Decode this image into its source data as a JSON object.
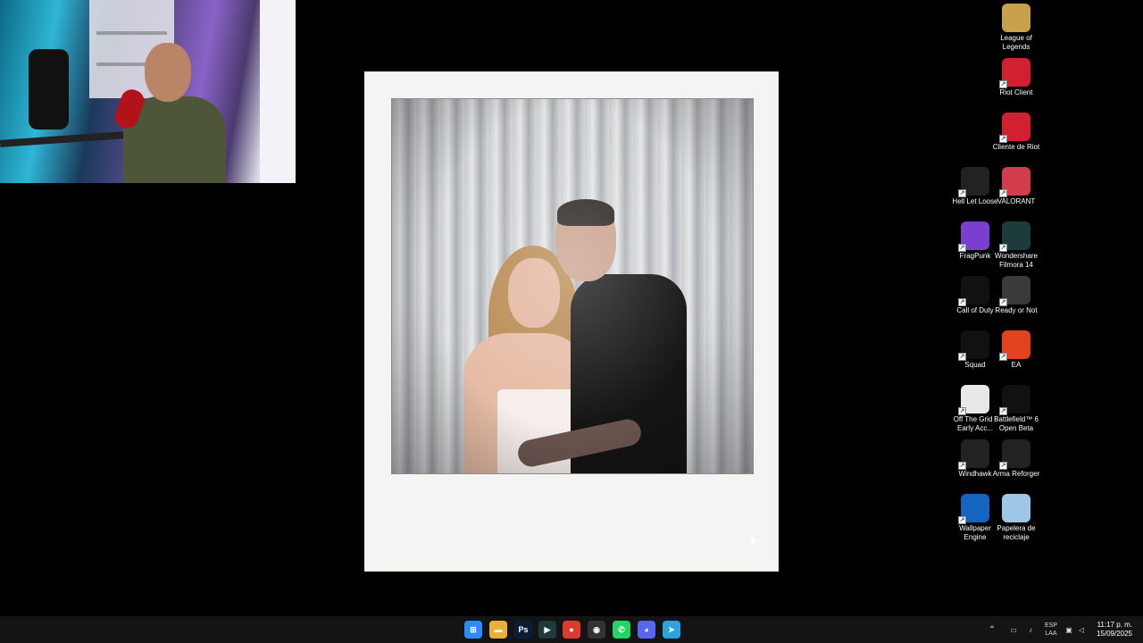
{
  "desktop_icons": [
    {
      "label": "League of Legends",
      "icon": "league-of-legends-icon",
      "color": "#c8a24a"
    },
    {
      "label": "Riot Client",
      "icon": "riot-client-icon",
      "color": "#d1202f"
    },
    {
      "label": "Cliente de Riot",
      "icon": "riot-client-es-icon",
      "color": "#d1202f"
    },
    {
      "label": "Hell Let Loose",
      "icon": "hell-let-loose-icon",
      "color": "#222222"
    },
    {
      "label": "VALORANT",
      "icon": "valorant-icon",
      "color": "#d13d4a"
    },
    {
      "label": "FragPunk",
      "icon": "fragpunk-icon",
      "color": "#7b3fd0"
    },
    {
      "label": "Wondershare Filmora 14",
      "icon": "filmora-icon",
      "color": "#1d3b3a"
    },
    {
      "label": "Call of Duty",
      "icon": "call-of-duty-icon",
      "color": "#111111"
    },
    {
      "label": "Ready or Not",
      "icon": "ready-or-not-icon",
      "color": "#3a3a3a"
    },
    {
      "label": "Squad",
      "icon": "squad-icon",
      "color": "#111111"
    },
    {
      "label": "EA",
      "icon": "ea-icon",
      "color": "#e0431e"
    },
    {
      "label": "Off The Grid - Early Acc...",
      "icon": "off-the-grid-icon",
      "color": "#e8e8e8"
    },
    {
      "label": "Battlefield™ 6 Open Beta",
      "icon": "battlefield-icon",
      "color": "#111111"
    },
    {
      "label": "Windhawk",
      "icon": "windhawk-icon",
      "color": "#222222"
    },
    {
      "label": "Arma Reforger",
      "icon": "arma-reforger-icon",
      "color": "#222222"
    },
    {
      "label": "Wallpaper Engine",
      "icon": "wallpaper-engine-icon",
      "color": "#1565c0"
    },
    {
      "label": "Papelera de reciclaje",
      "icon": "recycle-bin-icon",
      "color": "#9ec6e6"
    }
  ],
  "taskbar": {
    "apps": [
      {
        "name": "start-button",
        "glyph": "⊞",
        "color": "#2b8cff"
      },
      {
        "name": "file-explorer-icon",
        "glyph": "▬",
        "color": "#e8b03a"
      },
      {
        "name": "photoshop-icon",
        "glyph": "Ps",
        "color": "#0a1d35"
      },
      {
        "name": "filmora-taskbar-icon",
        "glyph": "▶",
        "color": "#1d3b3a"
      },
      {
        "name": "chrome-icon",
        "glyph": "●",
        "color": "#dd3b2f"
      },
      {
        "name": "obs-icon",
        "glyph": "◉",
        "color": "#333333"
      },
      {
        "name": "whatsapp-icon",
        "glyph": "✆",
        "color": "#25d366"
      },
      {
        "name": "discord-icon",
        "glyph": "◕",
        "color": "#5865f2"
      },
      {
        "name": "telegram-icon",
        "glyph": "➤",
        "color": "#2aa3de"
      }
    ],
    "lang_top": "ESP",
    "lang_bottom": "LAA",
    "time": "11:17 p. m.",
    "date": "15/09/2025"
  }
}
